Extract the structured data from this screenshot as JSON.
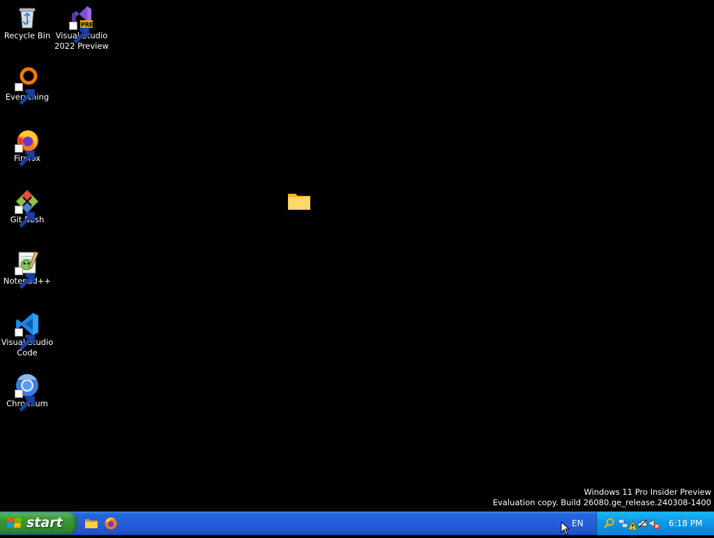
{
  "desktop": {
    "icons": [
      {
        "label": "Recycle Bin"
      },
      {
        "label": "Visual Studio 2022 Preview",
        "badge": "PRE"
      },
      {
        "label": "Everything"
      },
      {
        "label": "Firefox"
      },
      {
        "label": "Git Bash"
      },
      {
        "label": "Notepad++"
      },
      {
        "label": "Visual Studio Code"
      },
      {
        "label": "Chromium"
      }
    ]
  },
  "watermark": {
    "line1": "Windows 11 Pro Insider Preview",
    "line2": "Evaluation copy. Build 26080.ge_release.240308-1400"
  },
  "taskbar": {
    "start_label": "start",
    "quick_launch": [
      "folder-icon",
      "firefox-icon"
    ],
    "language": "EN",
    "clock": "6:18 PM",
    "tray_icons": [
      "search-icon",
      "network-icon",
      "warning-icon",
      "onedrive-icon",
      "volume-muted-icon"
    ]
  },
  "colors": {
    "taskbar": "#245edb",
    "start_button": "#3a9a3a",
    "tray": "#0f95e6",
    "desktop_background": "#000000"
  }
}
